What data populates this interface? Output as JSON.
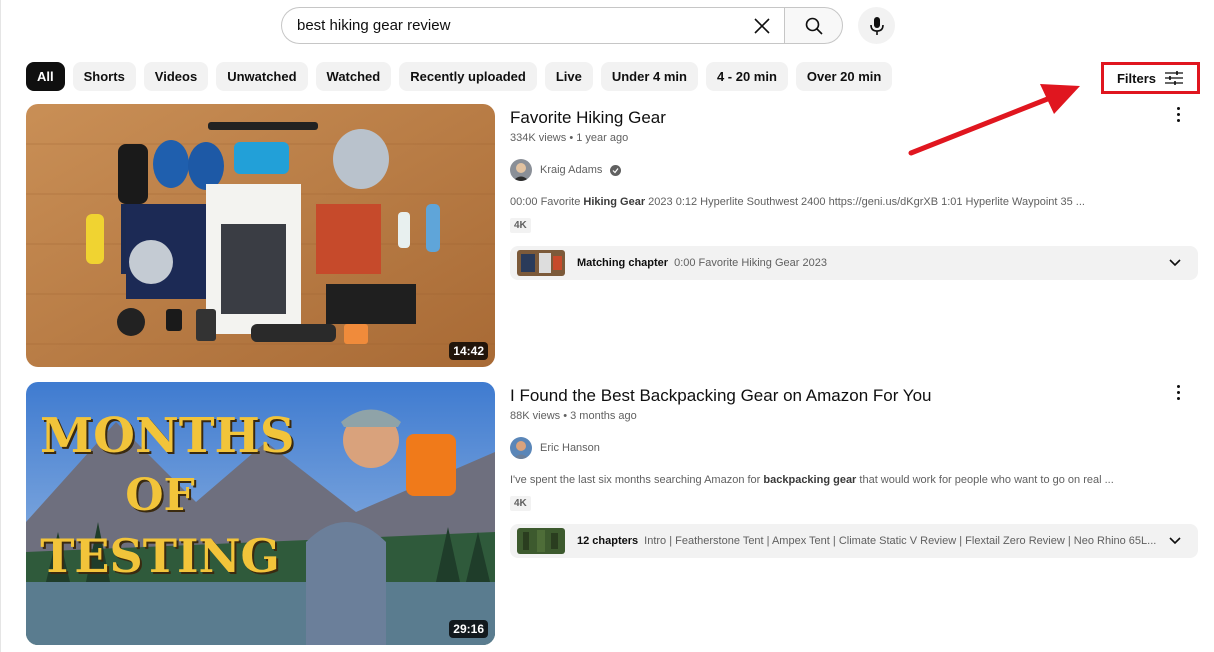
{
  "search": {
    "query": "best hiking gear review"
  },
  "chips": [
    {
      "label": "All",
      "active": true
    },
    {
      "label": "Shorts"
    },
    {
      "label": "Videos"
    },
    {
      "label": "Unwatched"
    },
    {
      "label": "Watched"
    },
    {
      "label": "Recently uploaded"
    },
    {
      "label": "Live"
    },
    {
      "label": "Under 4 min"
    },
    {
      "label": "4 - 20 min"
    },
    {
      "label": "Over 20 min"
    }
  ],
  "filters": {
    "label": "Filters"
  },
  "results": [
    {
      "title": "Favorite Hiking Gear",
      "views": "334K views",
      "age": "1 year ago",
      "channel": "Kraig Adams",
      "verified": true,
      "description_pre": "00:00 Favorite ",
      "description_bold": "Hiking Gear",
      "description_post": " 2023 0:12 Hyperlite Southwest 2400 https://geni.us/dKgrXB 1:01 Hyperlite Waypoint 35 ...",
      "badge": "4K",
      "chapter_label": "Matching chapter",
      "chapter_text": "0:00 Favorite Hiking Gear 2023",
      "duration": "14:42"
    },
    {
      "title": "I Found the Best Backpacking Gear on Amazon For You",
      "views": "88K views",
      "age": "3 months ago",
      "channel": "Eric Hanson",
      "verified": false,
      "description_pre": "I've spent the last six months searching Amazon for ",
      "description_bold": "backpacking gear",
      "description_post": " that would work for people who want to go on real ...",
      "badge": "4K",
      "chapter_label": "12 chapters",
      "chapter_text": "Intro | Featherstone Tent | Ampex Tent | Climate Static V Review | Flextail Zero Review | Neo Rhino 65L...",
      "duration": "29:16",
      "thumb_text": [
        "MONTHS",
        "OF",
        "TESTING"
      ]
    }
  ],
  "colors": {
    "accent_red": "#e0161f",
    "chip_bg": "#f2f2f2",
    "chip_active_bg": "#0f0f0f"
  }
}
